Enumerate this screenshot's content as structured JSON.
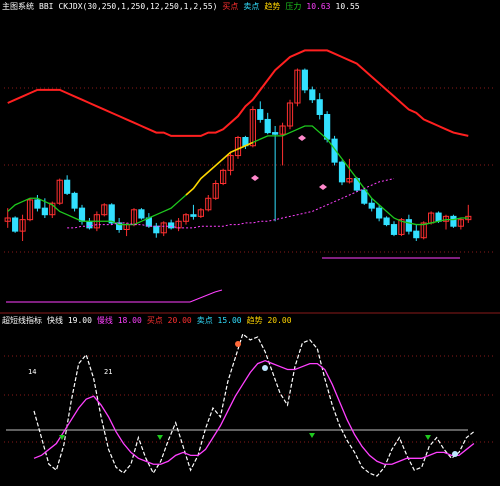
{
  "colors": {
    "background": "#000000",
    "grid": "#8a1a1a",
    "up": "#ff3030",
    "down": "#33e0ff",
    "ma_slow": "#ff2020",
    "ma_fast": "#1ec81e",
    "ma_fast_up": "#ffd400",
    "envelope": "#ff40ff",
    "white": "#ffffff",
    "ref_line": "#c0c0c0"
  },
  "top_header": [
    {
      "text": "主图系统",
      "color": "#ffffff"
    },
    {
      "text": "BBI",
      "color": "#ffffff"
    },
    {
      "text": "CKJDX(30,250,1,250,12,250,1,2,55)",
      "color": "#ffffff"
    },
    {
      "text": "买点",
      "color": "#ff3030"
    },
    {
      "text": "卖点",
      "color": "#33e0ff"
    },
    {
      "text": "趋势",
      "color": "#ffd400"
    },
    {
      "text": "压力",
      "color": "#1ec81e"
    },
    {
      "text": "10.63",
      "color": "#ff40ff"
    },
    {
      "text": "10.55",
      "color": "#ffffff"
    }
  ],
  "bottom_header": [
    {
      "text": "超短线指标",
      "color": "#ffffff"
    },
    {
      "text": "快线 19.00",
      "color": "#ffffff"
    },
    {
      "text": "慢线 18.00",
      "color": "#ff40ff"
    },
    {
      "text": "买点 20.00",
      "color": "#ff3030"
    },
    {
      "text": "卖点 15.00",
      "color": "#33e0ff"
    },
    {
      "text": "趋势 20.00",
      "color": "#ffd400"
    }
  ],
  "chart_data": [
    {
      "type": "candlestick",
      "title": "",
      "series": [
        {
          "name": "BBI",
          "role": "ma_slow"
        },
        {
          "name": "CKJDX",
          "role": "ma_fast"
        }
      ],
      "candles": [
        [
          10.3,
          10.7,
          10.1,
          10.4
        ],
        [
          10.4,
          10.45,
          9.95,
          10.0
        ],
        [
          10.0,
          10.5,
          9.7,
          10.35
        ],
        [
          10.35,
          11.0,
          10.3,
          10.95
        ],
        [
          10.95,
          11.1,
          10.6,
          10.7
        ],
        [
          10.7,
          11.0,
          10.4,
          10.5
        ],
        [
          10.5,
          10.9,
          10.4,
          10.85
        ],
        [
          10.85,
          11.6,
          10.8,
          11.55
        ],
        [
          11.55,
          11.7,
          11.1,
          11.15
        ],
        [
          11.15,
          11.2,
          10.6,
          10.7
        ],
        [
          10.7,
          10.8,
          10.2,
          10.3
        ],
        [
          10.3,
          10.4,
          10.05,
          10.1
        ],
        [
          10.1,
          10.6,
          10.0,
          10.5
        ],
        [
          10.5,
          10.85,
          10.45,
          10.8
        ],
        [
          10.8,
          10.85,
          10.2,
          10.25
        ],
        [
          10.25,
          10.4,
          9.95,
          10.05
        ],
        [
          10.05,
          10.25,
          9.85,
          10.2
        ],
        [
          10.2,
          10.7,
          10.15,
          10.65
        ],
        [
          10.65,
          10.7,
          10.35,
          10.4
        ],
        [
          10.4,
          10.55,
          10.1,
          10.15
        ],
        [
          10.15,
          10.25,
          9.8,
          9.95
        ],
        [
          9.95,
          10.3,
          9.85,
          10.25
        ],
        [
          10.25,
          10.35,
          10.05,
          10.1
        ],
        [
          10.1,
          10.4,
          10.0,
          10.3
        ],
        [
          10.3,
          10.55,
          10.2,
          10.5
        ],
        [
          10.5,
          10.8,
          10.35,
          10.45
        ],
        [
          10.45,
          10.7,
          10.4,
          10.65
        ],
        [
          10.65,
          11.1,
          10.6,
          11.0
        ],
        [
          11.0,
          11.55,
          10.95,
          11.45
        ],
        [
          11.45,
          11.9,
          11.4,
          11.85
        ],
        [
          11.85,
          12.4,
          11.7,
          12.3
        ],
        [
          12.3,
          12.9,
          12.2,
          12.85
        ],
        [
          12.85,
          12.9,
          12.5,
          12.6
        ],
        [
          12.6,
          13.8,
          12.55,
          13.7
        ],
        [
          13.7,
          13.95,
          13.3,
          13.4
        ],
        [
          13.4,
          13.6,
          12.95,
          13.0
        ],
        [
          13.0,
          13.2,
          10.3,
          12.95
        ],
        [
          12.95,
          13.3,
          12.0,
          13.2
        ],
        [
          13.2,
          14.0,
          13.1,
          13.9
        ],
        [
          13.9,
          14.95,
          13.8,
          14.9
        ],
        [
          14.9,
          14.95,
          14.2,
          14.3
        ],
        [
          14.3,
          14.4,
          13.9,
          14.0
        ],
        [
          14.0,
          14.2,
          13.4,
          13.55
        ],
        [
          13.55,
          13.65,
          12.7,
          12.8
        ],
        [
          12.8,
          12.9,
          12.0,
          12.1
        ],
        [
          12.1,
          12.15,
          11.4,
          11.5
        ],
        [
          11.5,
          12.2,
          11.45,
          11.6
        ],
        [
          11.6,
          11.65,
          11.2,
          11.25
        ],
        [
          11.25,
          11.3,
          10.8,
          10.85
        ],
        [
          10.85,
          11.0,
          10.6,
          10.7
        ],
        [
          10.7,
          10.8,
          10.3,
          10.4
        ],
        [
          10.4,
          10.45,
          10.15,
          10.2
        ],
        [
          10.2,
          10.3,
          9.85,
          9.9
        ],
        [
          9.9,
          10.4,
          9.85,
          10.35
        ],
        [
          10.35,
          10.5,
          9.9,
          10.0
        ],
        [
          10.0,
          10.2,
          9.7,
          9.8
        ],
        [
          9.8,
          10.3,
          9.75,
          10.25
        ],
        [
          10.25,
          10.6,
          10.2,
          10.55
        ],
        [
          10.55,
          10.6,
          10.25,
          10.3
        ],
        [
          10.3,
          10.5,
          10.05,
          10.45
        ],
        [
          10.45,
          10.5,
          10.1,
          10.15
        ],
        [
          10.15,
          10.4,
          10.05,
          10.35
        ],
        [
          10.35,
          10.8,
          10.25,
          10.45
        ]
      ],
      "ma_slow": [
        13.9,
        14.0,
        14.1,
        14.2,
        14.3,
        14.3,
        14.3,
        14.3,
        14.2,
        14.1,
        14.0,
        13.9,
        13.8,
        13.7,
        13.6,
        13.5,
        13.4,
        13.3,
        13.2,
        13.1,
        13.0,
        13.0,
        12.9,
        12.9,
        12.9,
        12.9,
        12.9,
        13.0,
        13.0,
        13.1,
        13.3,
        13.5,
        13.8,
        14.0,
        14.3,
        14.6,
        14.9,
        15.1,
        15.3,
        15.4,
        15.5,
        15.5,
        15.5,
        15.5,
        15.4,
        15.3,
        15.2,
        15.1,
        14.9,
        14.7,
        14.5,
        14.3,
        14.1,
        13.9,
        13.7,
        13.6,
        13.4,
        13.3,
        13.2,
        13.1,
        13.0,
        12.95,
        12.9
      ],
      "ma_fast": [
        10.6,
        10.8,
        10.9,
        11.0,
        11.0,
        10.9,
        10.8,
        10.6,
        10.5,
        10.4,
        10.3,
        10.3,
        10.3,
        10.3,
        10.3,
        10.2,
        10.2,
        10.2,
        10.3,
        10.4,
        10.5,
        10.6,
        10.7,
        10.9,
        11.1,
        11.3,
        11.6,
        11.8,
        12.0,
        12.2,
        12.4,
        12.5,
        12.6,
        12.7,
        12.8,
        12.9,
        12.9,
        12.9,
        13.0,
        13.1,
        13.2,
        13.2,
        13.0,
        12.8,
        12.5,
        12.2,
        11.9,
        11.6,
        11.3,
        11.0,
        10.8,
        10.6,
        10.4,
        10.3,
        10.25,
        10.2,
        10.2,
        10.25,
        10.3,
        10.35,
        10.35,
        10.4,
        10.4
      ],
      "envelope": [
        10.1,
        10.1,
        10.15,
        10.15,
        10.2,
        10.2,
        10.2,
        10.25,
        10.25,
        10.2,
        10.2,
        10.15,
        10.15,
        10.15,
        10.15,
        10.1,
        10.1,
        10.1,
        10.15,
        10.15,
        10.15,
        10.15,
        10.2,
        10.2,
        10.25,
        10.25,
        10.3,
        10.3,
        10.35,
        10.4,
        10.45,
        10.5,
        10.55,
        10.6,
        10.7,
        10.8,
        10.9,
        11.0,
        11.1,
        11.2,
        11.3,
        11.4,
        11.5,
        11.55,
        11.6
      ]
    },
    {
      "type": "line",
      "title": "",
      "series": [
        {
          "name": "快线",
          "role": "white",
          "values": [
            48,
            30,
            12,
            8,
            25,
            55,
            80,
            86,
            70,
            44,
            22,
            10,
            6,
            12,
            30,
            16,
            6,
            14,
            28,
            40,
            24,
            8,
            18,
            36,
            50,
            44,
            68,
            84,
            100,
            96,
            98,
            88,
            74,
            60,
            52,
            78,
            94,
            96,
            90,
            70,
            52,
            38,
            28,
            20,
            10,
            6,
            4,
            10,
            22,
            30,
            18,
            8,
            10,
            24,
            30,
            22,
            16,
            20,
            30,
            34
          ]
        },
        {
          "name": "慢线",
          "role": "envelope",
          "values": [
            16,
            18,
            22,
            26,
            34,
            42,
            50,
            56,
            58,
            52,
            44,
            34,
            26,
            20,
            16,
            14,
            12,
            12,
            14,
            18,
            20,
            18,
            18,
            22,
            30,
            38,
            48,
            58,
            66,
            74,
            80,
            82,
            80,
            78,
            76,
            76,
            78,
            80,
            80,
            76,
            66,
            54,
            42,
            32,
            24,
            18,
            14,
            12,
            12,
            14,
            16,
            16,
            16,
            18,
            20,
            20,
            18,
            18,
            22,
            26
          ]
        }
      ],
      "ylim": [
        0,
        100
      ],
      "annotations": [
        "14",
        "21"
      ]
    }
  ]
}
